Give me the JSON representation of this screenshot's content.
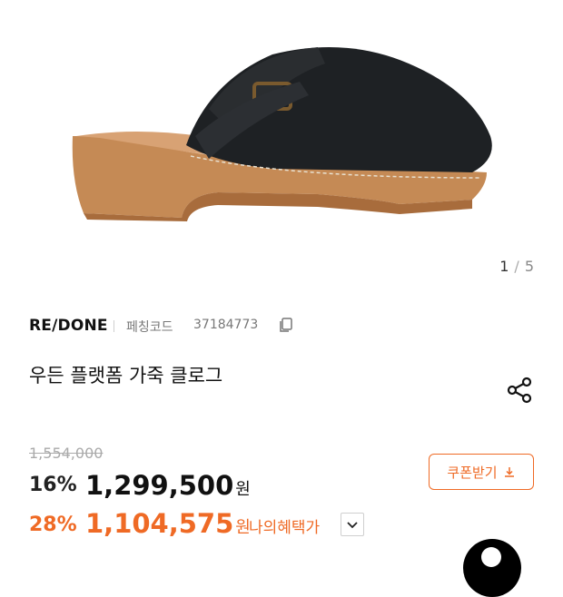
{
  "gallery": {
    "current": "1",
    "separator": "/",
    "total": "5"
  },
  "product": {
    "brand": "RE/DONE",
    "code_label": "페칭코드",
    "code_value": "37184773",
    "title": "우든 플랫폼 가죽 클로그"
  },
  "pricing": {
    "original_price": "1,554,000",
    "discount_rate": "16%",
    "price": "1,299,500",
    "won": "원",
    "my_discount_rate": "28%",
    "my_price": "1,104,575",
    "my_benefit_label": "나의혜택가"
  },
  "coupon": {
    "label": "쿠폰받기"
  },
  "colors": {
    "accent": "#ef6a25",
    "text": "#111111",
    "muted": "#777777"
  },
  "icons": [
    "copy-icon",
    "share-icon",
    "download-icon",
    "chevron-down-icon"
  ]
}
